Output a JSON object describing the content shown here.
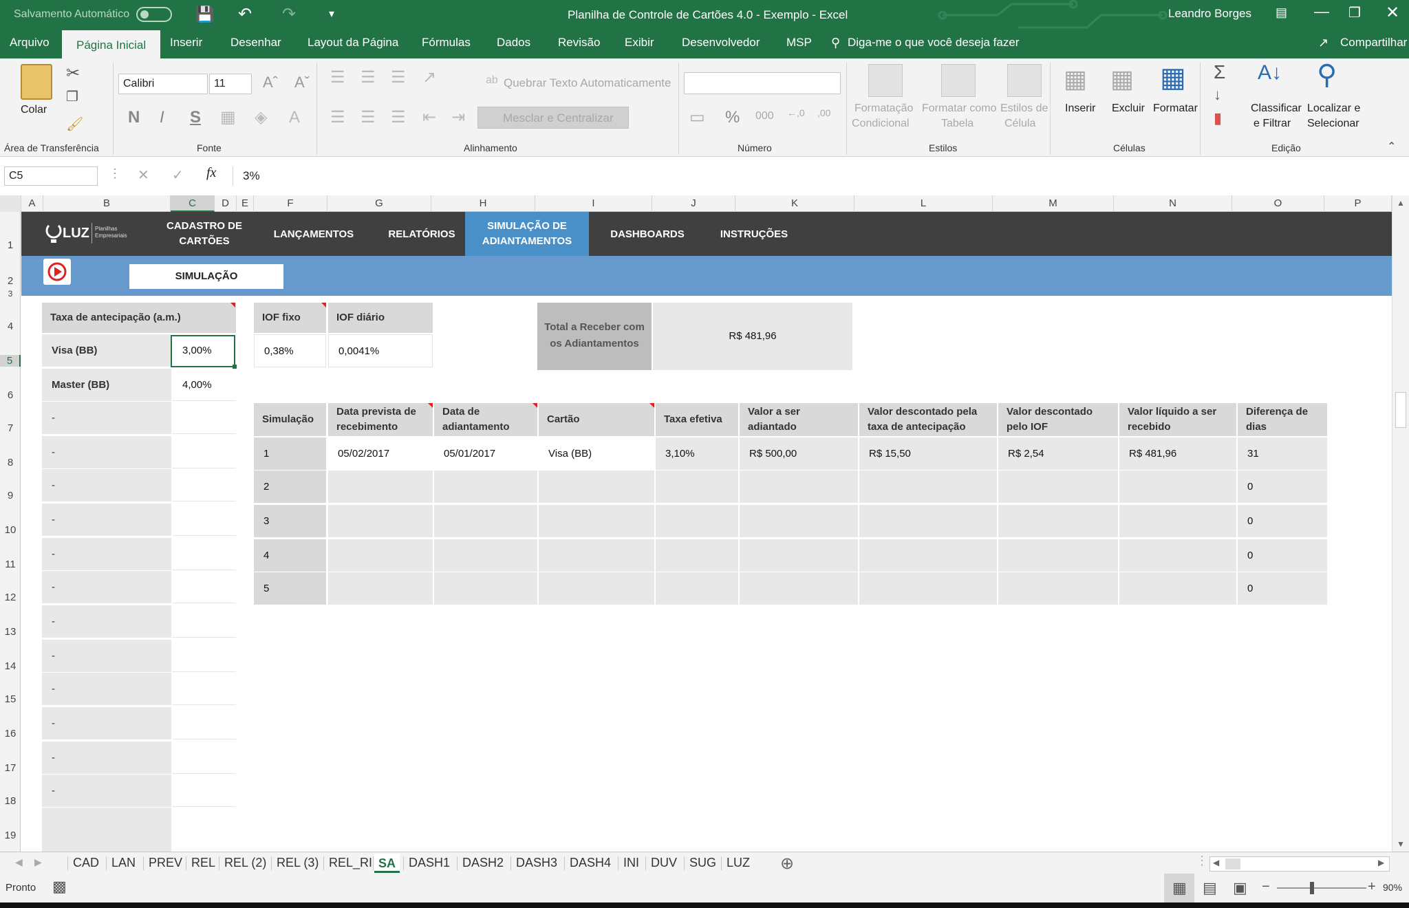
{
  "titlebar": {
    "autosave_label": "Salvamento Automático",
    "document_title": "Planilha de Controle de Cartões 4.0 - Exemplo  -  Excel",
    "user_name": "Leandro Borges"
  },
  "ribbon_tabs": [
    "Arquivo",
    "Página Inicial",
    "Inserir",
    "Desenhar",
    "Layout da Página",
    "Fórmulas",
    "Dados",
    "Revisão",
    "Exibir",
    "Desenvolvedor",
    "MSP"
  ],
  "tell_me": "Diga-me o que você deseja fazer",
  "share_label": "Compartilhar",
  "ribbon": {
    "paste": "Colar",
    "clipboard_group": "Área de Transferência",
    "font_name": "Calibri",
    "font_size": "11",
    "bold": "N",
    "italic": "I",
    "underline": "S",
    "font_group": "Fonte",
    "wrap_text": "Quebrar Texto Automaticamente",
    "merge_center": "Mesclar e Centralizar",
    "alignment_group": "Alinhamento",
    "number_group": "Número",
    "conditional_formatting": [
      "Formatação",
      "Condicional"
    ],
    "format_as_table": [
      "Formatar como",
      "Tabela"
    ],
    "cell_styles": [
      "Estilos de",
      "Célula"
    ],
    "styles_group": "Estilos",
    "insert": "Inserir",
    "delete": "Excluir",
    "format": "Formatar",
    "cells_group": "Células",
    "sort_filter": [
      "Classificar",
      "e Filtrar"
    ],
    "find_select": [
      "Localizar e",
      "Selecionar"
    ],
    "editing_group": "Edição"
  },
  "formula_bar": {
    "name_box": "C5",
    "formula": "3%"
  },
  "column_headers": [
    "A",
    "B",
    "C",
    "D",
    "E",
    "F",
    "G",
    "H",
    "I",
    "J",
    "K",
    "L",
    "M",
    "N",
    "O",
    "P"
  ],
  "row_headers": [
    "1",
    "2",
    "3",
    "4",
    "5",
    "6",
    "7",
    "8",
    "9",
    "10",
    "11",
    "12",
    "13",
    "14",
    "15",
    "16",
    "17",
    "18",
    "19"
  ],
  "nav": {
    "logo": "LUZ",
    "logo_sub": [
      "Planilhas",
      "Empresariais"
    ],
    "items": [
      {
        "label": "CADASTRO DE CARTÕES"
      },
      {
        "label": "LANÇAMENTOS"
      },
      {
        "label": "RELATÓRIOS"
      },
      {
        "label": "SIMULAÇÃO DE ADIANTAMENTOS"
      },
      {
        "label": "DASHBOARDS"
      },
      {
        "label": "INSTRUÇÕES"
      }
    ]
  },
  "sim_button": "SIMULAÇÃO",
  "rates": {
    "header": "Taxa de antecipação (a.m.)",
    "rows": [
      {
        "card": "Visa (BB)",
        "rate": "3,00%"
      },
      {
        "card": "Master (BB)",
        "rate": "4,00%"
      },
      {
        "card": "-",
        "rate": ""
      },
      {
        "card": "-",
        "rate": ""
      },
      {
        "card": "-",
        "rate": ""
      },
      {
        "card": "-",
        "rate": ""
      },
      {
        "card": "-",
        "rate": ""
      },
      {
        "card": "-",
        "rate": ""
      },
      {
        "card": "-",
        "rate": ""
      },
      {
        "card": "-",
        "rate": ""
      },
      {
        "card": "-",
        "rate": ""
      },
      {
        "card": "-",
        "rate": ""
      },
      {
        "card": "-",
        "rate": ""
      },
      {
        "card": "-",
        "rate": ""
      }
    ]
  },
  "iof": {
    "fixed_label": "IOF fixo",
    "daily_label": "IOF diário",
    "fixed_value": "0,38%",
    "daily_value": "0,0041%"
  },
  "total": {
    "label": "Total a Receber com os Adiantamentos",
    "value": "R$ 481,96"
  },
  "simulation_table": {
    "headers": [
      "Simulação",
      "Data prevista de recebimento",
      "Data de adiantamento",
      "Cartão",
      "Taxa efetiva",
      "Valor a ser adiantado",
      "Valor descontado pela taxa de antecipação",
      "Valor descontado pelo IOF",
      "Valor líquido a ser recebido",
      "Diferença de dias"
    ],
    "rows": [
      [
        "1",
        "05/02/2017",
        "05/01/2017",
        "Visa (BB)",
        "3,10%",
        "R$ 500,00",
        "R$ 15,50",
        "R$ 2,54",
        "R$ 481,96",
        "31"
      ],
      [
        "2",
        "",
        "",
        "",
        "",
        "",
        "",
        "",
        "",
        "0"
      ],
      [
        "3",
        "",
        "",
        "",
        "",
        "",
        "",
        "",
        "",
        "0"
      ],
      [
        "4",
        "",
        "",
        "",
        "",
        "",
        "",
        "",
        "",
        "0"
      ],
      [
        "5",
        "",
        "",
        "",
        "",
        "",
        "",
        "",
        "",
        "0"
      ]
    ]
  },
  "sheet_tabs": [
    "CAD",
    "LAN",
    "PREV",
    "REL",
    "REL (2)",
    "REL (3)",
    "REL_RI",
    "SA",
    "DASH1",
    "DASH2",
    "DASH3",
    "DASH4",
    "INI",
    "DUV",
    "SUG",
    "LUZ"
  ],
  "active_sheet": "SA",
  "status": {
    "ready": "Pronto",
    "zoom": "90%"
  },
  "colors": {
    "excel_green": "#217346",
    "nav_dark": "#404040",
    "nav_active": "#4a90c8",
    "band_blue": "#6699cc"
  }
}
